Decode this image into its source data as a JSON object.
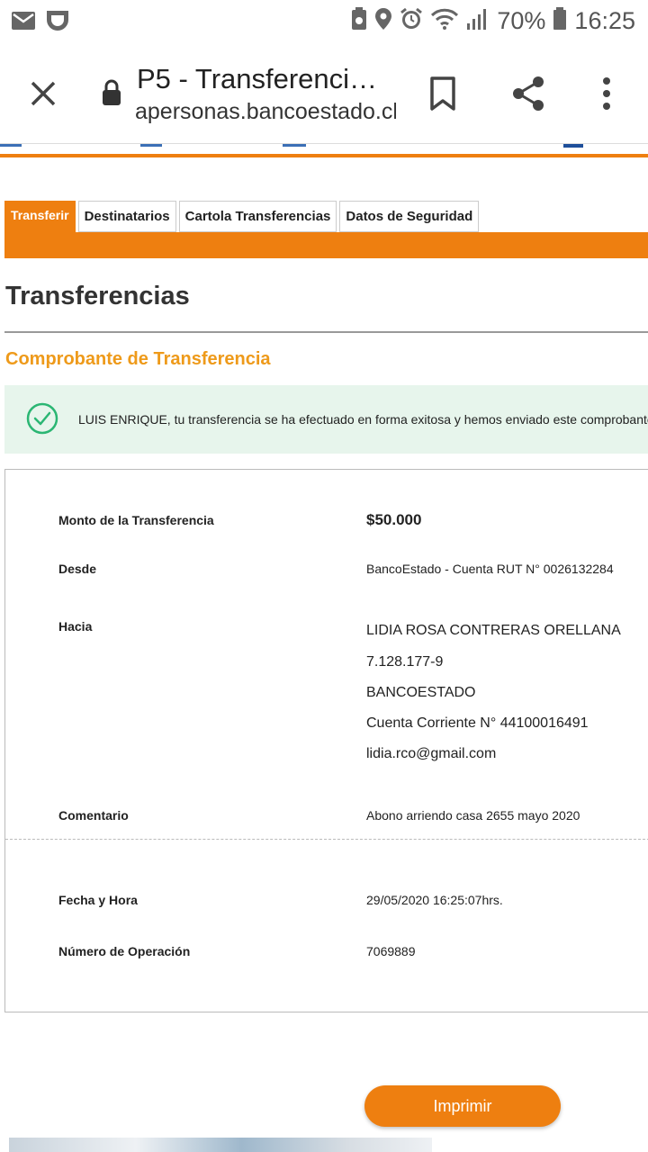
{
  "status_bar": {
    "battery": "70%",
    "time": "16:25",
    "icons": [
      "mail-icon",
      "app-icon",
      "battery-saver-icon",
      "location-icon",
      "alarm-icon",
      "wifi-icon",
      "signal-icon",
      "battery-icon"
    ]
  },
  "browser": {
    "title": "P5 - Transferenci…",
    "url": "apersonas.bancoestado.cl",
    "icons": [
      "close-icon",
      "lock-icon",
      "bookmark-icon",
      "share-icon",
      "more-vert-icon"
    ]
  },
  "tabs": [
    {
      "label": "Transferir",
      "active": true
    },
    {
      "label": "Destinatarios",
      "active": false
    },
    {
      "label": "Cartola Transferencias",
      "active": false
    },
    {
      "label": "Datos de Seguridad",
      "active": false
    }
  ],
  "page": {
    "title": "Transferencias",
    "subtitle": "Comprobante de Transferencia",
    "alert_text": "LUIS ENRIQUE, tu transferencia se ha efectuado en forma exitosa y hemos enviado este comprobante"
  },
  "receipt": {
    "monto_label": "Monto de la Transferencia",
    "monto_value": "$50.000",
    "desde_label": "Desde",
    "desde_value": "BancoEstado - Cuenta RUT N° 0026132284",
    "hacia_label": "Hacia",
    "hacia_lines": [
      "LIDIA ROSA CONTRERAS ORELLANA",
      "7.128.177-9",
      "BANCOESTADO",
      "Cuenta Corriente N° 44100016491",
      "lidia.rco@gmail.com"
    ],
    "comentario_label": "Comentario",
    "comentario_value": "Abono arriendo casa 2655 mayo 2020",
    "fecha_label": "Fecha y Hora",
    "fecha_value": "29/05/2020 16:25:07hrs.",
    "operacion_label": "Número de Operación",
    "operacion_value": "7069889"
  },
  "actions": {
    "print_label": "Imprimir"
  },
  "colors": {
    "accent": "#ee7f10",
    "subtitle": "#ee9a1a",
    "success_bg": "#e7f5ec",
    "success_icon": "#2bb673"
  }
}
